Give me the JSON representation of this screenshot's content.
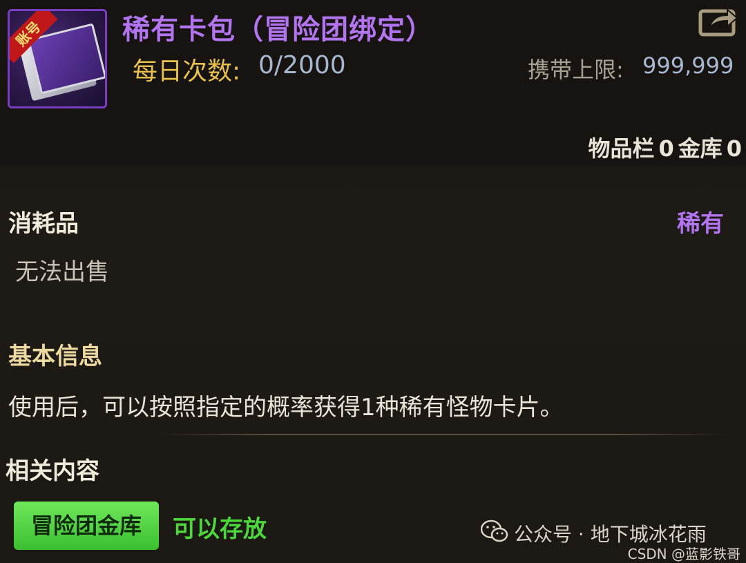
{
  "item": {
    "icon_tag": "账号",
    "icon_name": "rare-card-pack-icon",
    "name": "稀有卡包（冒险团绑定）",
    "daily_label": "每日次数:",
    "daily_value": "0/2000",
    "carry_label": "携带上限:",
    "carry_value": "999,999",
    "inventory_label": "物品栏",
    "inventory_count": "0",
    "vault_label": "金库",
    "vault_count": "0"
  },
  "details": {
    "category": "消耗品",
    "rarity": "稀有",
    "unsellable": "无法出售",
    "basic_info_title": "基本信息",
    "description": "使用后，可以按照指定的概率获得1种稀有怪物卡片。",
    "related_title": "相关内容",
    "storage_button": "冒险团金库",
    "storable_text": "可以存放"
  },
  "watermark": {
    "text": "公众号 · 地下城冰花雨",
    "csdn": "CSDN @蓝影铁哥"
  },
  "colors": {
    "rare": "#b374f0",
    "daily_label": "#e8c24a",
    "value": "#a8b8d0",
    "green_button": "#4cd83a"
  }
}
